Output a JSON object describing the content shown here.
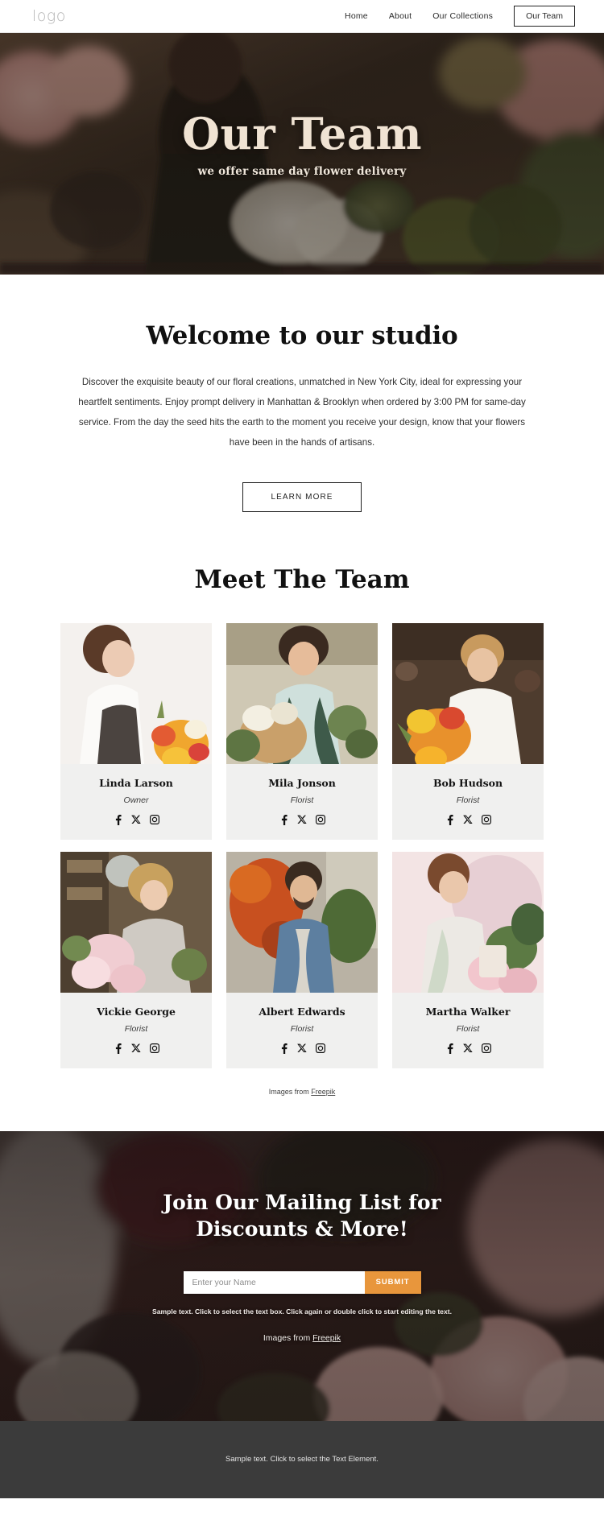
{
  "header": {
    "logo": "logo",
    "nav": [
      {
        "label": "Home",
        "active": false
      },
      {
        "label": "About",
        "active": false
      },
      {
        "label": "Our Collections",
        "active": false
      }
    ],
    "cta": "Our Team"
  },
  "hero": {
    "title": "Our Team",
    "subtitle": "we offer same day flower delivery"
  },
  "welcome": {
    "heading": "Welcome to our studio",
    "body": "Discover the exquisite beauty of our floral creations, unmatched in New York City, ideal for expressing your heartfelt sentiments. Enjoy prompt delivery in Manhattan & Brooklyn when ordered by 3:00 PM for same-day service.  From the day the seed hits the earth to the moment you receive your design, know that your flowers have been in the hands of artisans.",
    "button": "LEARN MORE"
  },
  "team": {
    "heading": "Meet The Team",
    "members": [
      {
        "name": "Linda Larson",
        "role": "Owner"
      },
      {
        "name": "Mila Jonson",
        "role": "Florist"
      },
      {
        "name": "Bob Hudson",
        "role": "Florist"
      },
      {
        "name": "Vickie George",
        "role": "Florist"
      },
      {
        "name": "Albert Edwards",
        "role": "Florist"
      },
      {
        "name": "Martha Walker",
        "role": "Florist"
      }
    ],
    "social_icons": [
      "facebook-icon",
      "x-twitter-icon",
      "instagram-icon"
    ],
    "credit_prefix": "Images from ",
    "credit_link": "Freepik"
  },
  "mailing": {
    "title_line1": "Join Our Mailing List for",
    "title_line2": "Discounts & More!",
    "input_placeholder": "Enter your Name",
    "input_value": "",
    "submit": "SUBMIT",
    "note": "Sample text. Click to select the text box. Click again or double click to start editing the text.",
    "credit_prefix": "Images from ",
    "credit_link": "Freepik"
  },
  "footer": {
    "text": "Sample text. Click to select the Text Element."
  },
  "colors": {
    "accent_orange": "#e8963c",
    "hero_title": "#f0e3d3",
    "card_bg": "#f0f0ef",
    "footer_bg": "#3b3b3b"
  }
}
